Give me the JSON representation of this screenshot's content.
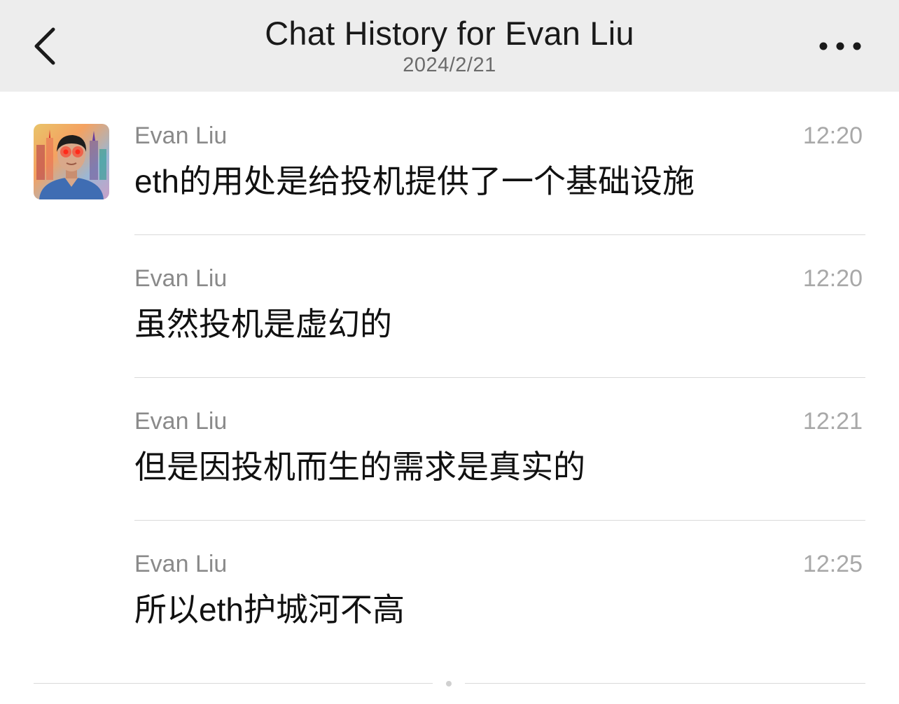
{
  "header": {
    "title": "Chat History for Evan Liu",
    "subtitle": "2024/2/21",
    "back_icon": "chevron-left-icon",
    "more_icon": "ellipsis-icon"
  },
  "messages": [
    {
      "sender": "Evan Liu",
      "time": "12:20",
      "text": "eth的用处是给投机提供了一个基础设施"
    },
    {
      "sender": "Evan Liu",
      "time": "12:20",
      "text": "虽然投机是虚幻的"
    },
    {
      "sender": "Evan Liu",
      "time": "12:21",
      "text": "但是因投机而生的需求是真实的"
    },
    {
      "sender": "Evan Liu",
      "time": "12:25",
      "text": "所以eth护城河不高"
    }
  ],
  "colors": {
    "header_bg": "#ededed",
    "avatar_eye_glow": "#ff2a1a"
  }
}
